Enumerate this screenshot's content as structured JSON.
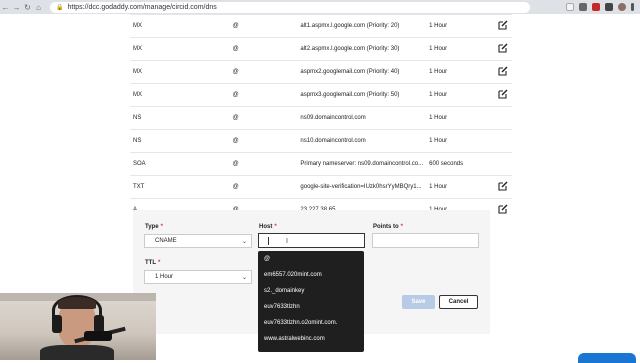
{
  "browser": {
    "url": "https://dcc.godaddy.com/manage/circid.com/dns"
  },
  "dns_records": [
    {
      "type": "MX",
      "host": "@",
      "value": "alt1.aspmx.l.google.com (Priority: 20)",
      "ttl": "1 Hour",
      "editable": true
    },
    {
      "type": "MX",
      "host": "@",
      "value": "alt2.aspmx.l.google.com (Priority: 30)",
      "ttl": "1 Hour",
      "editable": true
    },
    {
      "type": "MX",
      "host": "@",
      "value": "aspmx2.googlemail.com (Priority: 40)",
      "ttl": "1 Hour",
      "editable": true
    },
    {
      "type": "MX",
      "host": "@",
      "value": "aspmx3.googlemail.com (Priority: 50)",
      "ttl": "1 Hour",
      "editable": true
    },
    {
      "type": "NS",
      "host": "@",
      "value": "ns09.domaincontrol.com",
      "ttl": "1 Hour",
      "editable": false
    },
    {
      "type": "NS",
      "host": "@",
      "value": "ns10.domaincontrol.com",
      "ttl": "1 Hour",
      "editable": false
    },
    {
      "type": "SOA",
      "host": "@",
      "value": "Primary nameserver: ns09.domaincontrol.co...",
      "ttl": "600 seconds",
      "editable": false
    },
    {
      "type": "TXT",
      "host": "@",
      "value": "google-site-verification=IUzk0hsrYyMBQry1...",
      "ttl": "1 Hour",
      "editable": true
    },
    {
      "type": "A",
      "host": "@",
      "value": "23.227.38.65",
      "ttl": "1 Hour",
      "editable": true
    }
  ],
  "form": {
    "type_label": "Type",
    "type_value": "CNAME",
    "host_label": "Host",
    "host_value": "",
    "points_to_label": "Points to",
    "ttl_label": "TTL",
    "ttl_value": "1 Hour",
    "required_mark": "*",
    "save_label": "Save",
    "cancel_label": "Cancel"
  },
  "host_suggestions": [
    "@",
    "em6557.020mint.com",
    "s2._domainkey",
    "euv7633tlzhn",
    "euv7633tlzhn.o2omint.com.",
    "www.astralwebinc.com"
  ],
  "colors": {
    "required": "#d9304f",
    "save_disabled": "#b7cbe6",
    "chat_button": "#1976d2"
  }
}
